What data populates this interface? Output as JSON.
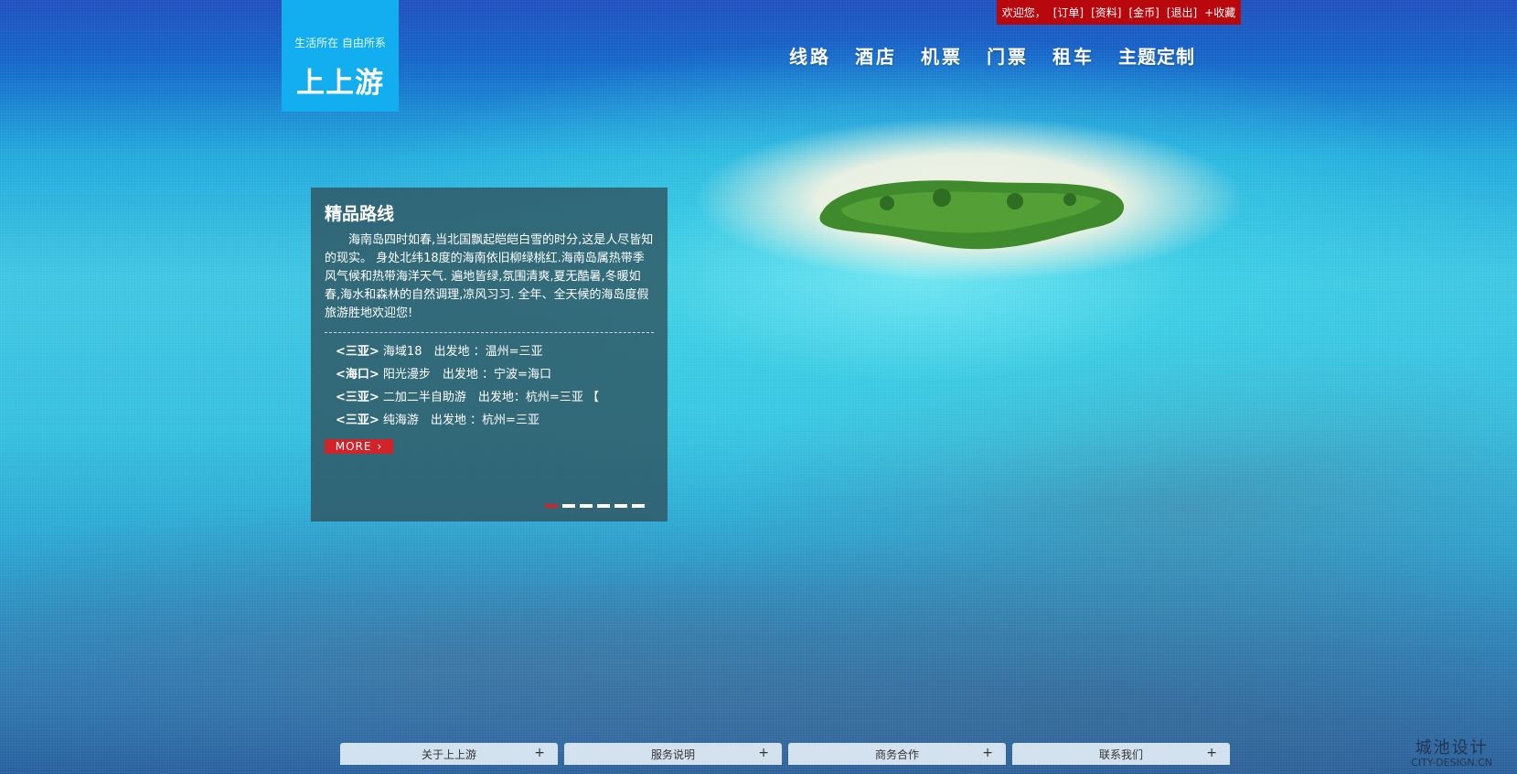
{
  "brand": {
    "tagline": "生活所在 自由所系",
    "name": "上上游"
  },
  "topbar": {
    "welcome": "欢迎您，",
    "orders": "[订单]",
    "profile": "[资料]",
    "coins": "[金币]",
    "logout": "[退出]",
    "favorite": "+收藏"
  },
  "nav": {
    "items": [
      {
        "label": "线路"
      },
      {
        "label": "酒店"
      },
      {
        "label": "机票"
      },
      {
        "label": "门票"
      },
      {
        "label": "租车"
      },
      {
        "label": "主题定制"
      }
    ]
  },
  "feature": {
    "title": "精品路线",
    "description": "海南岛四时如春,当北国飘起皑皑白雪的时分,这是人尽皆知的现实。 身处北纬18度的海南依旧柳绿桃红.海南岛属热带季风气候和热带海洋天气. 遍地皆绿,氛围清爽,夏无酷暑,冬暖如春,海水和森林的自然调理,凉风习习. 全年、全天候的海岛度假旅游胜地欢迎您!",
    "routes": [
      {
        "tag": "<三亚>",
        "text": " 海域18　出发地 ：温州=三亚"
      },
      {
        "tag": "<海口>",
        "text": " 阳光漫步　出发地 ：宁波=海口"
      },
      {
        "tag": "<三亚>",
        "text": " 二加二半自助游　出发地：杭州=三亚 【"
      },
      {
        "tag": "<三亚>",
        "text": " 纯海游　出发地 ：杭州=三亚"
      }
    ],
    "more_label": "MORE",
    "more_arrow": "›",
    "slides_total": 6,
    "slides_active": 1
  },
  "footer": {
    "tabs": [
      {
        "label": "关于上上游",
        "icon": "+"
      },
      {
        "label": "服务说明",
        "icon": "+"
      },
      {
        "label": "商务合作",
        "icon": "+"
      },
      {
        "label": "联系我们",
        "icon": "+"
      }
    ]
  },
  "watermark": {
    "cn": "城池设计",
    "en": "CITY-DESIGN.CN"
  },
  "colors": {
    "logo_bg": "#12aef0",
    "topbar_bg": "#b8080d",
    "accent_red": "#d1232a",
    "panel_bg": "#2f5562"
  }
}
